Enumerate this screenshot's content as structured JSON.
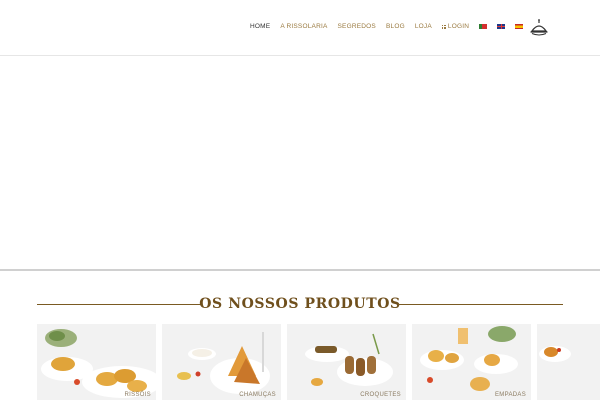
{
  "nav": {
    "items": [
      "HOME",
      "A RISSOLARIA",
      "SEGREDOS",
      "BLOG",
      "LOJA"
    ],
    "login_label": "LOGIN",
    "languages": [
      "pt-flag",
      "en-flag",
      "es-flag"
    ]
  },
  "section": {
    "title": "OS NOSSOS PRODUTOS"
  },
  "products": [
    {
      "label": "RISSÓIS"
    },
    {
      "label": "CHAMUÇAS"
    },
    {
      "label": "CROQUETES"
    },
    {
      "label": "EMPADAS"
    },
    {
      "label": ""
    }
  ],
  "colors": {
    "accent": "#9a7a40",
    "title": "#6f4f1c",
    "active_nav": "#333333"
  }
}
